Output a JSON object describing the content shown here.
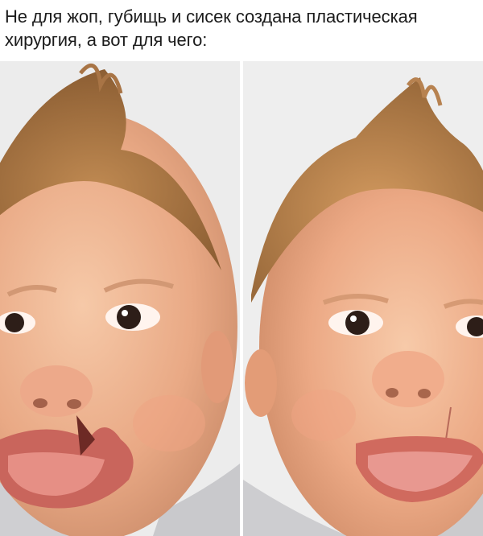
{
  "post": {
    "caption": "Не для жоп, губищь и сисек создана пластическая хирургия, а вот для чего:"
  },
  "images": [
    {
      "name": "before-surgery-photo",
      "desc_icon": "baby-face-cleft-lip"
    },
    {
      "name": "after-surgery-photo",
      "desc_icon": "baby-face-repaired-lip"
    }
  ]
}
